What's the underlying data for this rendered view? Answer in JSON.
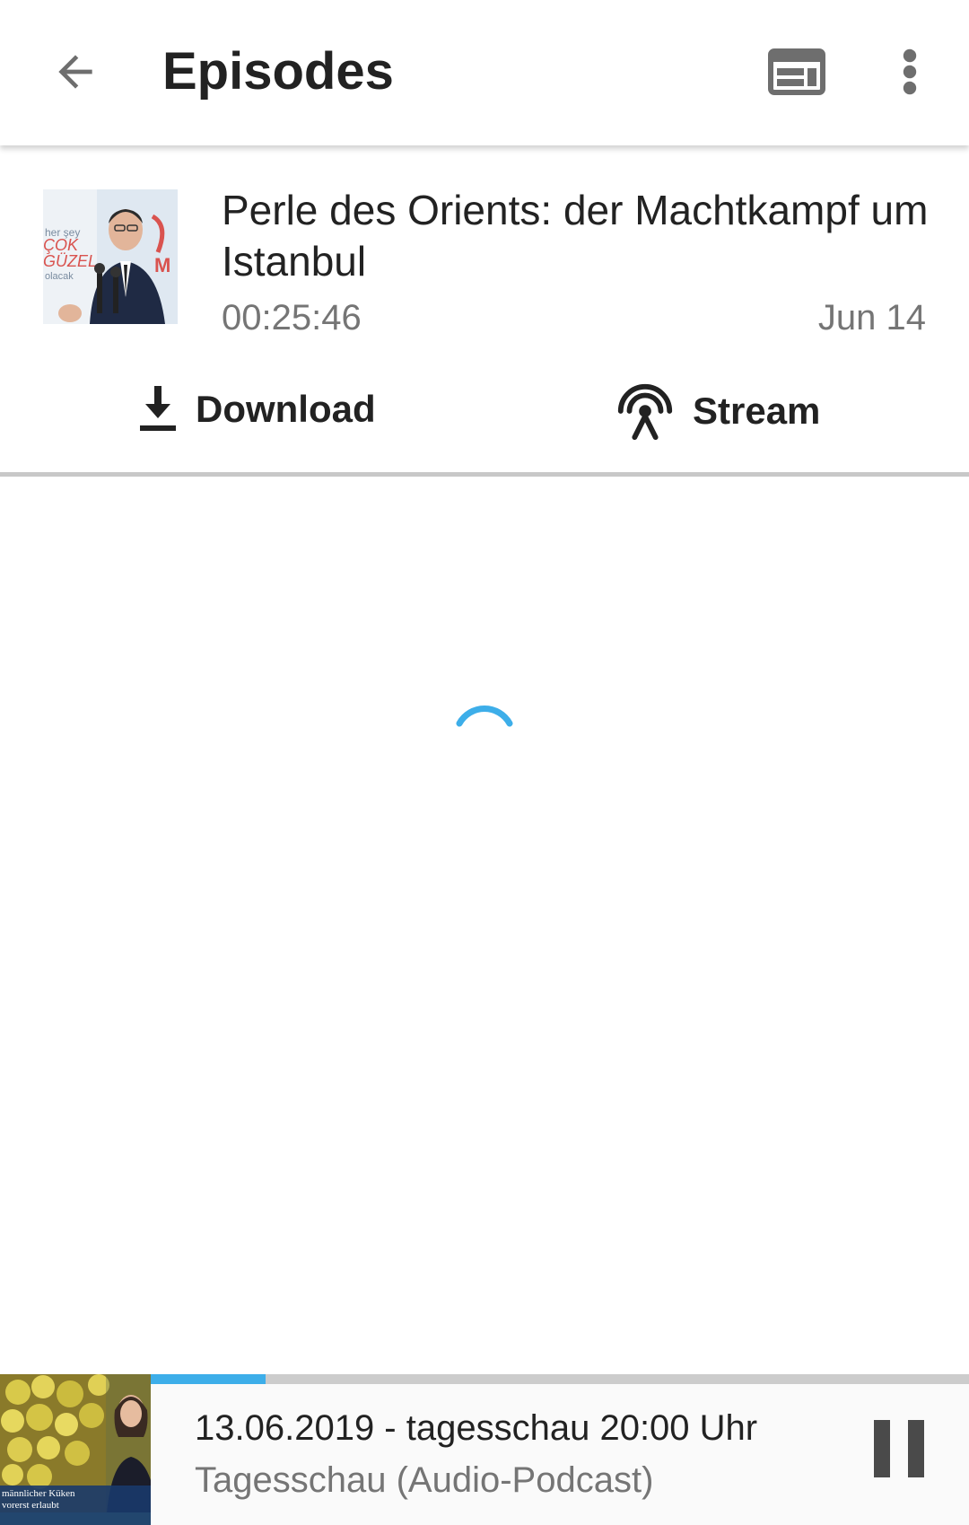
{
  "toolbar": {
    "title": "Episodes",
    "back_icon": "arrow-back-icon",
    "web_icon": "web-view-icon",
    "more_icon": "more-vert-icon"
  },
  "episode": {
    "title": "Perle des Orients: der Machtkampf um Istanbul",
    "duration": "00:25:46",
    "date": "Jun 14",
    "thumbnail_icon": "episode-cover-image",
    "download_label": "Download",
    "download_icon": "download-icon",
    "stream_label": "Stream",
    "stream_icon": "stream-antenna-icon"
  },
  "content": {
    "loading": true,
    "spinner_icon": "loading-spinner-icon"
  },
  "player": {
    "title": "13.06.2019 - tagesschau 20:00 Uhr",
    "subtitle": "Tagesschau (Audio-Podcast)",
    "progress": 0.14,
    "pause_icon": "pause-icon",
    "thumbnail_icon": "podcast-cover-image"
  },
  "colors": {
    "accent": "#3daee9",
    "text_primary": "#222222",
    "text_secondary": "#757575",
    "divider": "#c8c8c8"
  }
}
